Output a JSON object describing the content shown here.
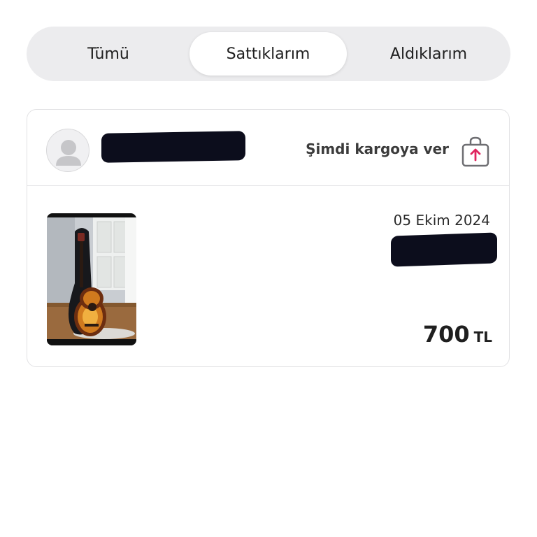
{
  "tabs": [
    {
      "label": "Tümü",
      "selected": false
    },
    {
      "label": "Sattıklarım",
      "selected": true
    },
    {
      "label": "Aldıklarım",
      "selected": false
    }
  ],
  "order": {
    "action_label": "Şimdi kargoya ver",
    "action_icon": "shipping-box-arrow-up-icon",
    "date": "05 Ekim 2024",
    "price_amount": "700",
    "price_currency": "TL"
  },
  "colors": {
    "accent": "#e0245e",
    "segment_bg": "#ececee",
    "redaction": "#0c0d1c"
  }
}
